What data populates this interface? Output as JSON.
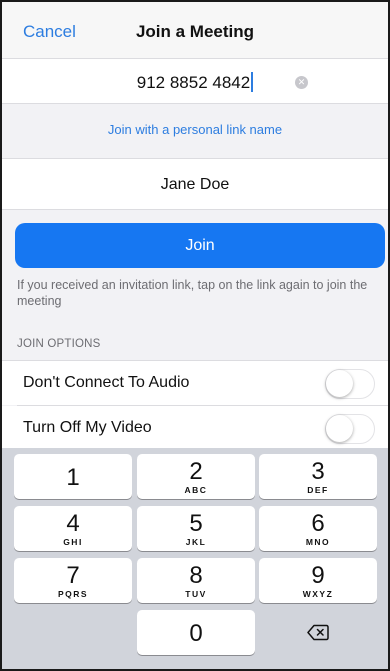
{
  "navbar": {
    "cancel_label": "Cancel",
    "title": "Join a Meeting"
  },
  "meeting": {
    "id_value": "912 8852 4842",
    "clear_icon": "clear-circle-icon"
  },
  "personal_link_label": "Join with a personal link name",
  "name": {
    "value": "Jane Doe"
  },
  "join_label": "Join",
  "hint": "If you received an invitation link, tap on the link again to join the meeting",
  "join_options": {
    "header": "JOIN OPTIONS",
    "items": [
      {
        "label": "Don't Connect To Audio",
        "on": false
      },
      {
        "label": "Turn Off My Video",
        "on": false
      }
    ]
  },
  "keypad": {
    "keys": [
      {
        "digit": "1",
        "letters": ""
      },
      {
        "digit": "2",
        "letters": "ABC"
      },
      {
        "digit": "3",
        "letters": "DEF"
      },
      {
        "digit": "4",
        "letters": "GHI"
      },
      {
        "digit": "5",
        "letters": "JKL"
      },
      {
        "digit": "6",
        "letters": "MNO"
      },
      {
        "digit": "7",
        "letters": "PQRS"
      },
      {
        "digit": "8",
        "letters": "TUV"
      },
      {
        "digit": "9",
        "letters": "WXYZ"
      },
      {
        "digit": "0",
        "letters": ""
      }
    ],
    "delete_icon": "backspace-icon"
  },
  "colors": {
    "accent": "#2d7de0",
    "join_button": "#1677f2",
    "keypad_bg": "#d1d4db"
  }
}
